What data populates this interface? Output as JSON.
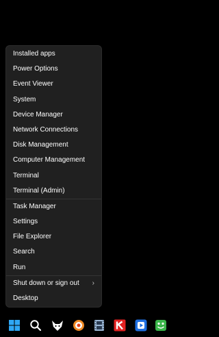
{
  "menu": {
    "groups": [
      [
        {
          "label": "Installed apps"
        },
        {
          "label": "Power Options"
        },
        {
          "label": "Event Viewer"
        },
        {
          "label": "System"
        },
        {
          "label": "Device Manager"
        },
        {
          "label": "Network Connections"
        },
        {
          "label": "Disk Management"
        },
        {
          "label": "Computer Management"
        },
        {
          "label": "Terminal"
        },
        {
          "label": "Terminal (Admin)"
        }
      ],
      [
        {
          "label": "Task Manager"
        },
        {
          "label": "Settings"
        },
        {
          "label": "File Explorer"
        },
        {
          "label": "Search"
        },
        {
          "label": "Run"
        }
      ],
      [
        {
          "label": "Shut down or sign out",
          "submenu": true
        },
        {
          "label": "Desktop"
        }
      ]
    ],
    "submenu_glyph": "›"
  },
  "taskbar": {
    "icons": [
      {
        "name": "windows-start-icon",
        "color": "#2fa7f5"
      },
      {
        "name": "search-icon",
        "color": "#ffffff"
      },
      {
        "name": "fox-app-icon",
        "color": "#ffffff"
      },
      {
        "name": "orange-circle-app-icon",
        "color": "#f08a24"
      },
      {
        "name": "film-strip-icon",
        "color": "#9bb7d4"
      },
      {
        "name": "k-app-icon",
        "color": "#e32222"
      },
      {
        "name": "blue-play-app-icon",
        "color": "#1f6fe0"
      },
      {
        "name": "green-app-icon",
        "color": "#3bb54a"
      }
    ]
  }
}
